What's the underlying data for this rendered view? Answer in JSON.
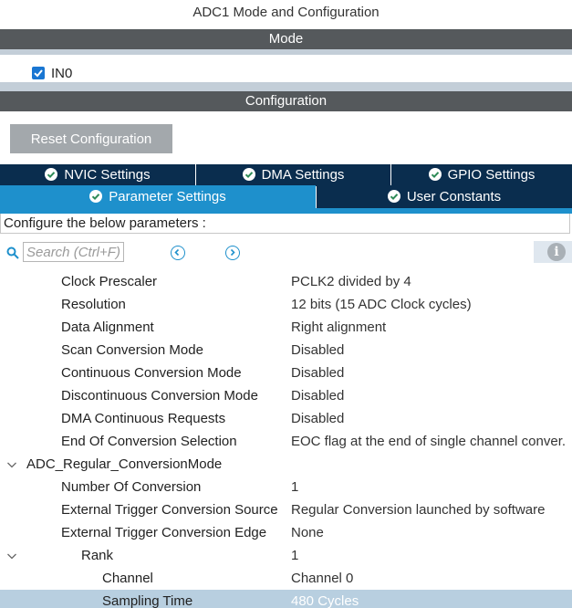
{
  "window": {
    "title": "ADC1 Mode and Configuration"
  },
  "mode": {
    "header": "Mode",
    "in0": {
      "label": "IN0",
      "checked": true
    }
  },
  "configuration": {
    "header": "Configuration",
    "reset_label": "Reset Configuration",
    "tabs": {
      "nvic": "NVIC Settings",
      "dma": "DMA Settings",
      "gpio": "GPIO Settings",
      "parameter": "Parameter Settings",
      "user_constants": "User Constants"
    },
    "configure_text": "Configure the below parameters :",
    "search": {
      "placeholder": "Search (Ctrl+F)"
    },
    "params": {
      "clock_prescaler": {
        "key": "Clock Prescaler",
        "value": "PCLK2 divided by 4"
      },
      "resolution": {
        "key": "Resolution",
        "value": "12 bits (15 ADC Clock cycles)"
      },
      "data_alignment": {
        "key": "Data Alignment",
        "value": "Right alignment"
      },
      "scan_conversion": {
        "key": "Scan Conversion Mode",
        "value": "Disabled"
      },
      "continuous_conversion": {
        "key": "Continuous Conversion Mode",
        "value": "Disabled"
      },
      "discontinuous_conversion": {
        "key": "Discontinuous Conversion Mode",
        "value": "Disabled"
      },
      "dma_continuous": {
        "key": "DMA Continuous Requests",
        "value": "Disabled"
      },
      "eoc_selection": {
        "key": "End Of Conversion Selection",
        "value": "EOC flag at the end of single channel conver."
      },
      "regular_group": {
        "key": "ADC_Regular_ConversionMode"
      },
      "num_conversion": {
        "key": "Number Of Conversion",
        "value": "1"
      },
      "ext_trigger_source": {
        "key": "External Trigger Conversion Source",
        "value": "Regular Conversion launched by software"
      },
      "ext_trigger_edge": {
        "key": "External Trigger Conversion Edge",
        "value": "None"
      },
      "rank": {
        "key": "Rank",
        "value": "1"
      },
      "channel": {
        "key": "Channel",
        "value": "Channel 0"
      },
      "sampling_time": {
        "key": "Sampling Time",
        "value": "480 Cycles"
      }
    }
  },
  "colors": {
    "header_bar": "#55595c",
    "tab_dark": "#0a2d4e",
    "tab_active": "#1e90cc",
    "selected_row": "#b8cfe0"
  },
  "icons": [
    "check-icon",
    "search-icon",
    "prev-icon",
    "next-icon",
    "info-icon",
    "chevron-down-icon"
  ]
}
